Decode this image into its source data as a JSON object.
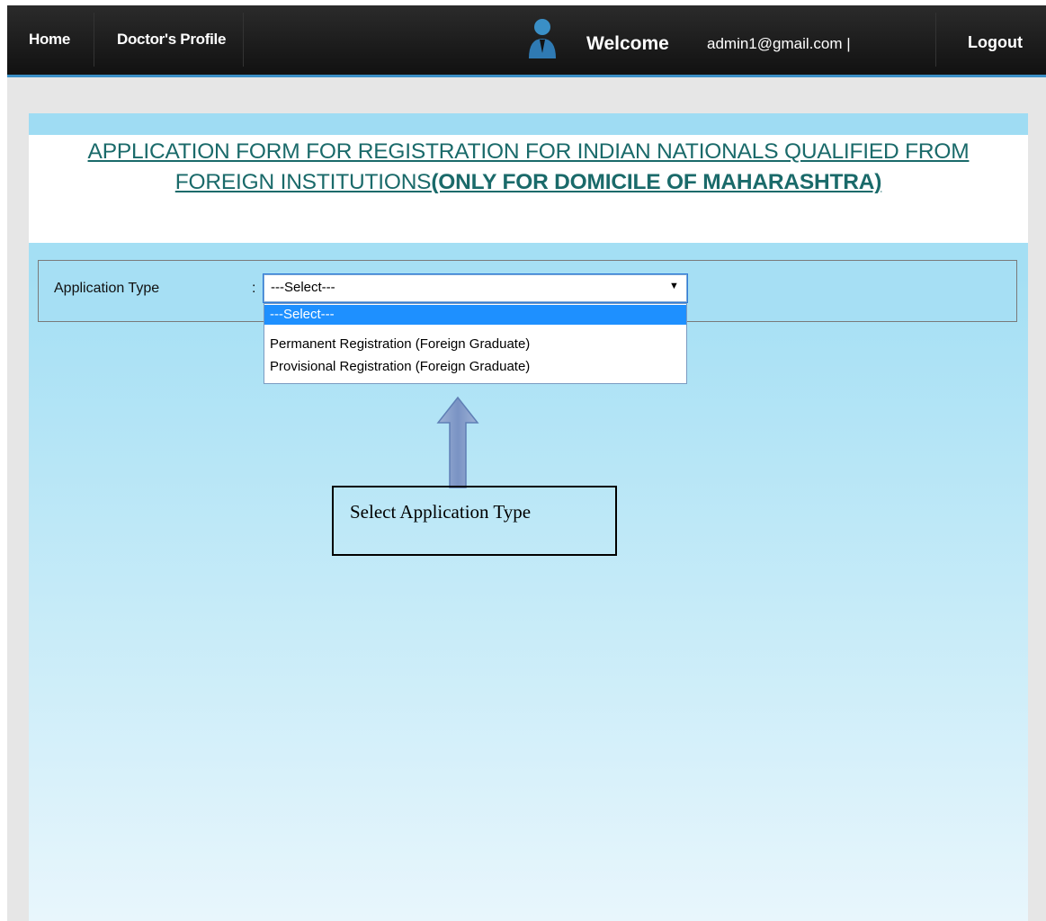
{
  "nav": {
    "home": "Home",
    "doctors_profile": "Doctor's Profile",
    "welcome": "Welcome",
    "user_email": "admin1@gmail.com |",
    "logout": "Logout"
  },
  "page": {
    "title_plain": "APPLICATION FORM FOR REGISTRATION FOR INDIAN NATIONALS QUALIFIED FROM FOREIGN INSTITUTIONS",
    "title_bold": "(ONLY FOR DOMICILE OF MAHARASHTRA)"
  },
  "form": {
    "application_type_label": "Application Type",
    "colon": ":",
    "selected_value": "---Select---",
    "options": [
      "---Select---",
      "Permanent Registration (Foreign Graduate)",
      "Provisional Registration (Foreign Graduate)"
    ]
  },
  "annotation": {
    "callout_text": "Select Application Type"
  },
  "colors": {
    "topbar": "#1a1a1a",
    "accent_border": "#3a8fc6",
    "panel_blue": "#a4dff4",
    "title_teal": "#1a6a6a",
    "option_highlight": "#1e90ff"
  }
}
